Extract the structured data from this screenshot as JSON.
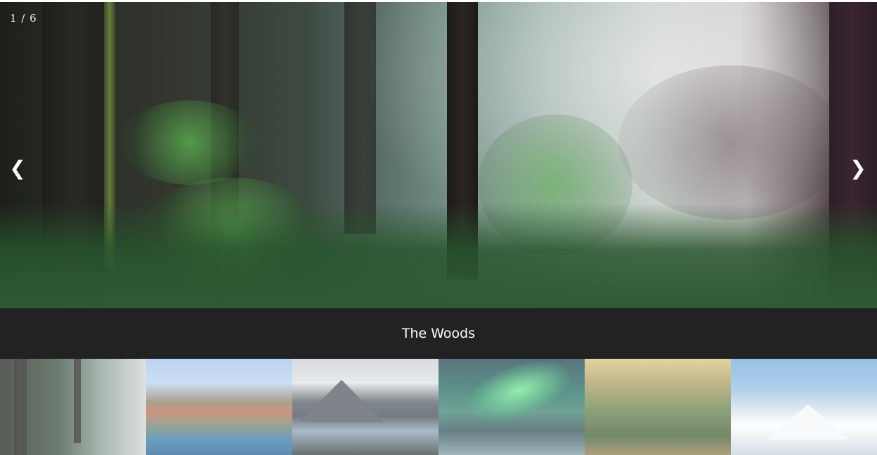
{
  "slideshow": {
    "counter": "1 / 6",
    "prev_icon": "chevron-left-icon",
    "next_icon": "chevron-right-icon",
    "prev_glyph": "❮",
    "next_glyph": "❯",
    "caption": "The Woods",
    "current_index": 1,
    "total": 6
  },
  "thumbnails": [
    {
      "name": "thumb-woods",
      "active": true
    },
    {
      "name": "thumb-cinque-terre",
      "active": false
    },
    {
      "name": "thumb-mountains-lake",
      "active": false
    },
    {
      "name": "thumb-northern-lights",
      "active": false
    },
    {
      "name": "thumb-forest-valley",
      "active": false
    },
    {
      "name": "thumb-snow-mountains",
      "active": false
    }
  ],
  "colors": {
    "caption_bg": "#222222",
    "caption_text": "#ffffff"
  }
}
